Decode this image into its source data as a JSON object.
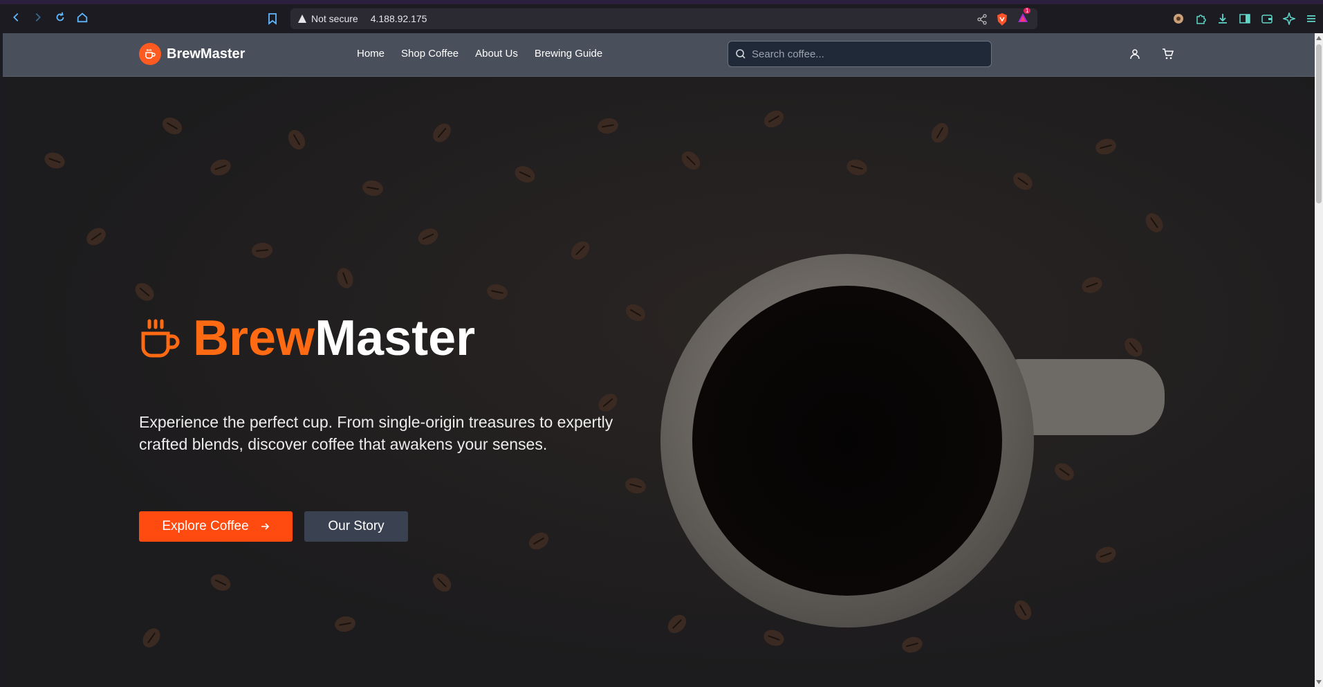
{
  "browser": {
    "security_label": "Not secure",
    "url": "4.188.92.175",
    "badge_count": "1"
  },
  "header": {
    "brand": "BrewMaster",
    "nav": [
      "Home",
      "Shop Coffee",
      "About Us",
      "Brewing Guide"
    ],
    "search_placeholder": "Search coffee..."
  },
  "hero": {
    "title_part1": "Brew",
    "title_part2": "Master",
    "description": "Experience the perfect cup. From single-origin treasures to expertly crafted blends, discover coffee that awakens your senses.",
    "primary_button": "Explore Coffee",
    "secondary_button": "Our Story"
  },
  "colors": {
    "accent": "#ff5a1f",
    "header_bg": "#4a4f5c",
    "secondary_button": "#3a4150"
  }
}
